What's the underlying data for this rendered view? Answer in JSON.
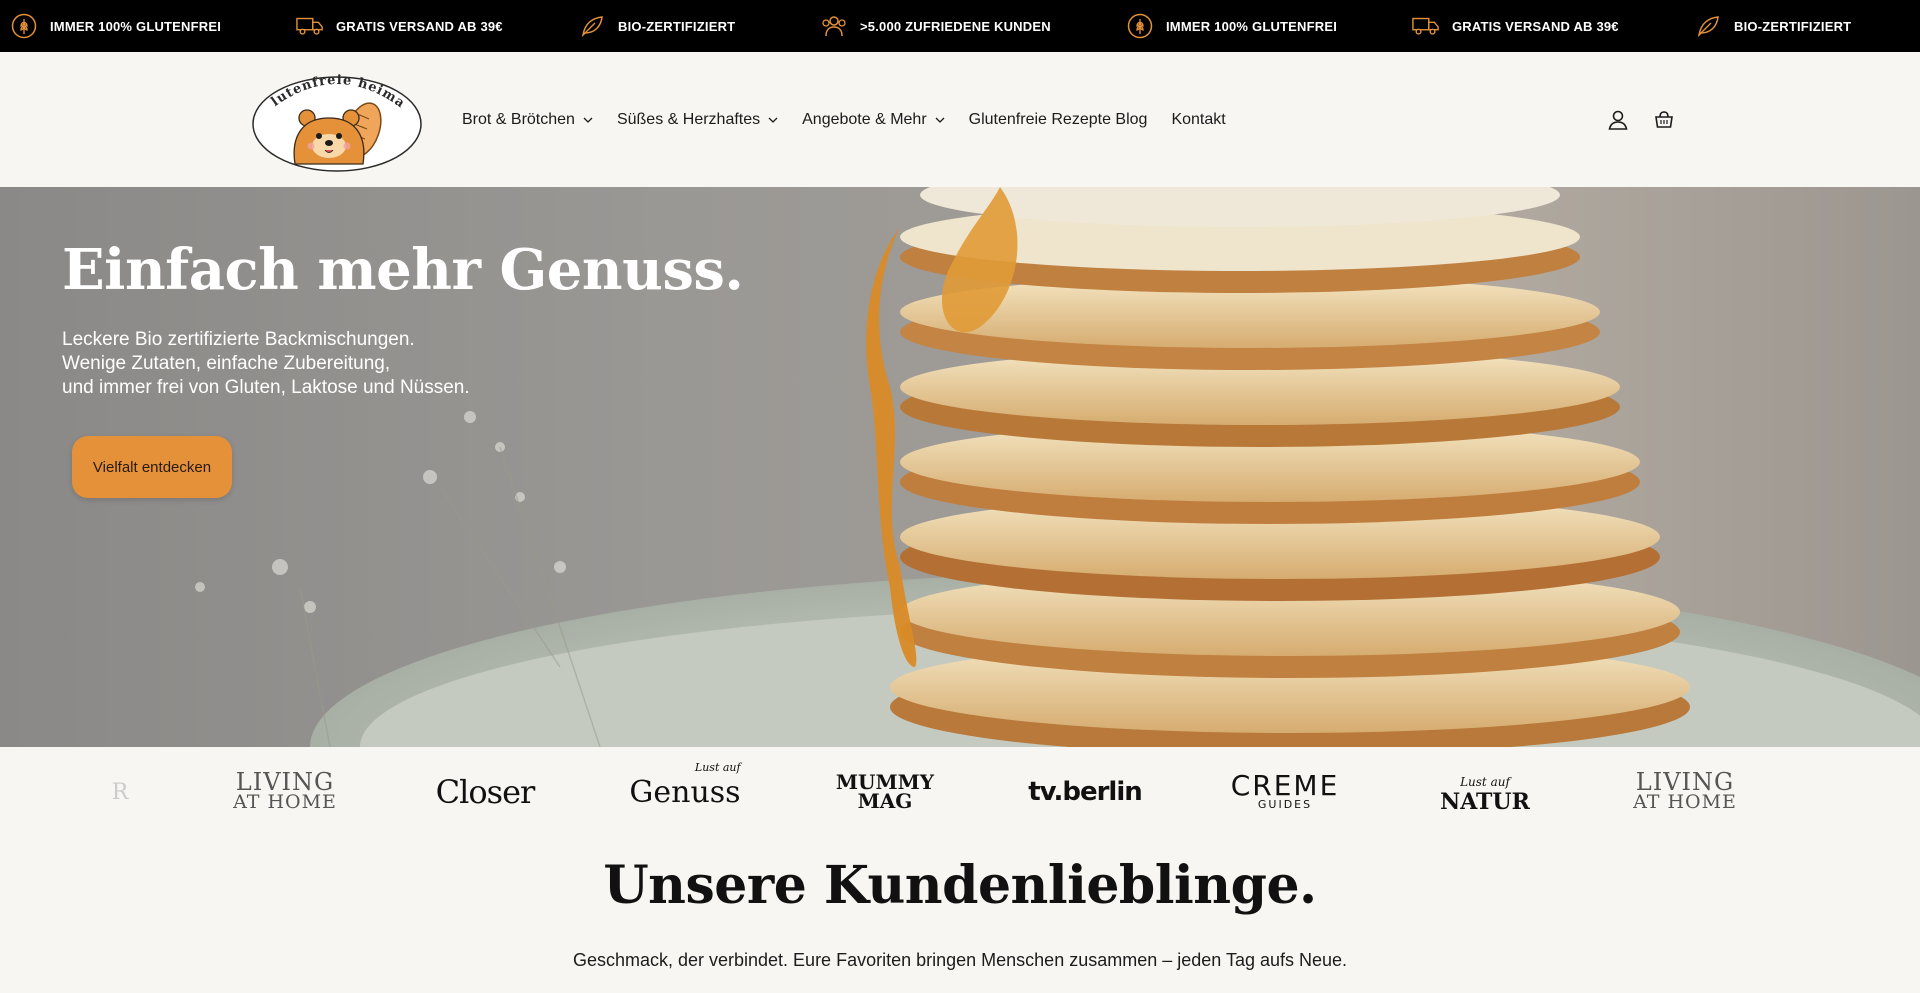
{
  "announcement_bar": {
    "items": [
      {
        "label": "IMMER 100% GLUTENFREI",
        "icon": "wheat-icon"
      },
      {
        "label": "GRATIS VERSAND AB 39€",
        "icon": "truck-icon"
      },
      {
        "label": "BIO-ZERTIFIZIERT",
        "icon": "leaf-icon"
      },
      {
        "label": ">5.000 ZUFRIEDENE KUNDEN",
        "icon": "customers-icon"
      },
      {
        "label": "IMMER 100% GLUTENFREI",
        "icon": "wheat-icon"
      },
      {
        "label": "GRATIS VERSAND AB 39€",
        "icon": "truck-icon"
      },
      {
        "label": "BIO-ZERTIFIZIERT",
        "icon": "leaf-icon"
      }
    ],
    "accent_color": "#e4913a"
  },
  "header": {
    "logo_text": "glutenfreie heimat",
    "nav": [
      {
        "label": "Brot & Brötchen",
        "has_dropdown": true
      },
      {
        "label": "Süßes & Herzhaftes",
        "has_dropdown": true
      },
      {
        "label": "Angebote & Mehr",
        "has_dropdown": true
      },
      {
        "label": "Glutenfreie Rezepte Blog",
        "has_dropdown": false
      },
      {
        "label": "Kontakt",
        "has_dropdown": false
      }
    ],
    "icons": [
      "account-icon",
      "cart-icon"
    ]
  },
  "hero": {
    "title": "Einfach mehr Genuss.",
    "subtitle_lines": [
      "Leckere Bio zertifizierte Backmischungen.",
      "Wenige Zutaten, einfache Zubereitung,",
      "und immer frei von Gluten, Laktose und Nüssen."
    ],
    "cta_label": "Vielfalt entdecken",
    "cta_color": "#e4913a"
  },
  "press": {
    "logos": [
      {
        "name": "R"
      },
      {
        "name": "LIVING",
        "sub": "AT HOME"
      },
      {
        "name": "Closer"
      },
      {
        "name": "Genuss",
        "sub": "Lust auf"
      },
      {
        "name": "MUMMY",
        "sub": "MAG"
      },
      {
        "name": "tv.berlin"
      },
      {
        "name": "CREME",
        "sub": "GUIDES"
      },
      {
        "name": "NATUR",
        "sub": "Lust auf"
      },
      {
        "name": "LIVING",
        "sub": "AT HOME"
      }
    ]
  },
  "section": {
    "title": "Unsere Kundenlieblinge.",
    "subtitle": "Geschmack, der verbindet. Eure Favoriten bringen Menschen zusammen – jeden Tag aufs Neue."
  }
}
